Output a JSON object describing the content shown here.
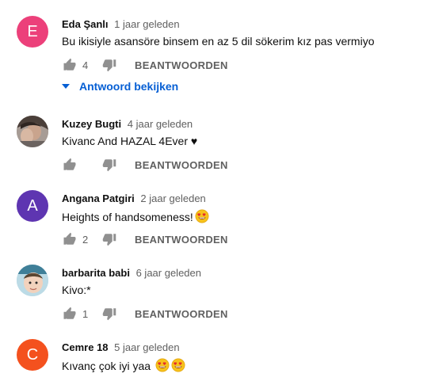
{
  "comments": [
    {
      "author": "Eda Şanlı",
      "time": "1 jaar geleden",
      "text": "Bu ikisiyle asansöre binsem en az 5 dil sökerim kız pas vermiyo",
      "likes": "4",
      "reply_label": "BEANTWOORDEN",
      "avatar_letter": "E",
      "avatar_color": "#ec407a",
      "view_replies": "Antwoord bekijken"
    },
    {
      "author": "Kuzey Bugti",
      "time": "4 jaar geleden",
      "text": "Kivanc And HAZAL 4Ever ♥",
      "likes": "",
      "reply_label": "BEANTWOORDEN",
      "avatar_letter": "",
      "avatar_color": "#8a7f78"
    },
    {
      "author": "Angana Patgiri",
      "time": "2 jaar geleden",
      "text": "Heights of handsomeness!",
      "likes": "2",
      "reply_label": "BEANTWOORDEN",
      "avatar_letter": "A",
      "avatar_color": "#5e35b1"
    },
    {
      "author": "barbarita babi",
      "time": "6 jaar geleden",
      "text": "Kivo:*",
      "likes": "1",
      "reply_label": "BEANTWOORDEN",
      "avatar_letter": "",
      "avatar_color": "#9ec7d6"
    },
    {
      "author": "Cemre 18",
      "time": "5 jaar geleden",
      "text": "Kıvanç çok iyi yaa",
      "likes": "",
      "reply_label": "BEANTWOORDEN",
      "avatar_letter": "C",
      "avatar_color": "#f4511e"
    }
  ]
}
